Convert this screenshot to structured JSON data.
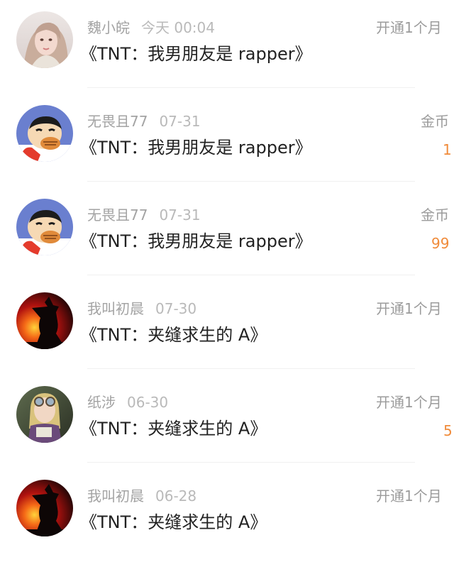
{
  "colors": {
    "name_text": "#a3a3a3",
    "time_text": "#b9b9b9",
    "title_text": "#222222",
    "action_text": "#9b9b9b",
    "coin_orange": "#f08b3a",
    "divider": "#f0f0f0"
  },
  "rows": [
    {
      "name": "魏小皖",
      "time": "今天 00:04",
      "title": "《TNT：我男朋友是 rapper》",
      "action": "开通1个月",
      "amount": "",
      "avatar_icon": "girl-portrait-avatar-icon"
    },
    {
      "name": "无畏且77",
      "time": "07-31",
      "title": "《TNT：我男朋友是 rapper》",
      "action": "金币",
      "amount": "1",
      "avatar_icon": "cartoon-boy-eating-avatar-icon"
    },
    {
      "name": "无畏且77",
      "time": "07-31",
      "title": "《TNT：我男朋友是 rapper》",
      "action": "金币",
      "amount": "99",
      "avatar_icon": "cartoon-boy-eating-avatar-icon"
    },
    {
      "name": "我叫初晨",
      "time": "07-30",
      "title": "《TNT：夹缝求生的 A》",
      "action": "开通1个月",
      "amount": "",
      "avatar_icon": "silhouette-sunset-avatar-icon"
    },
    {
      "name": "纸涉",
      "time": "06-30",
      "title": "《TNT：夹缝求生的 A》",
      "action": "开通1个月",
      "amount": "5",
      "avatar_icon": "person-with-goggles-avatar-icon"
    },
    {
      "name": "我叫初晨",
      "time": "06-28",
      "title": "《TNT：夹缝求生的 A》",
      "action": "开通1个月",
      "amount": "",
      "avatar_icon": "silhouette-sunset-avatar-icon"
    }
  ]
}
